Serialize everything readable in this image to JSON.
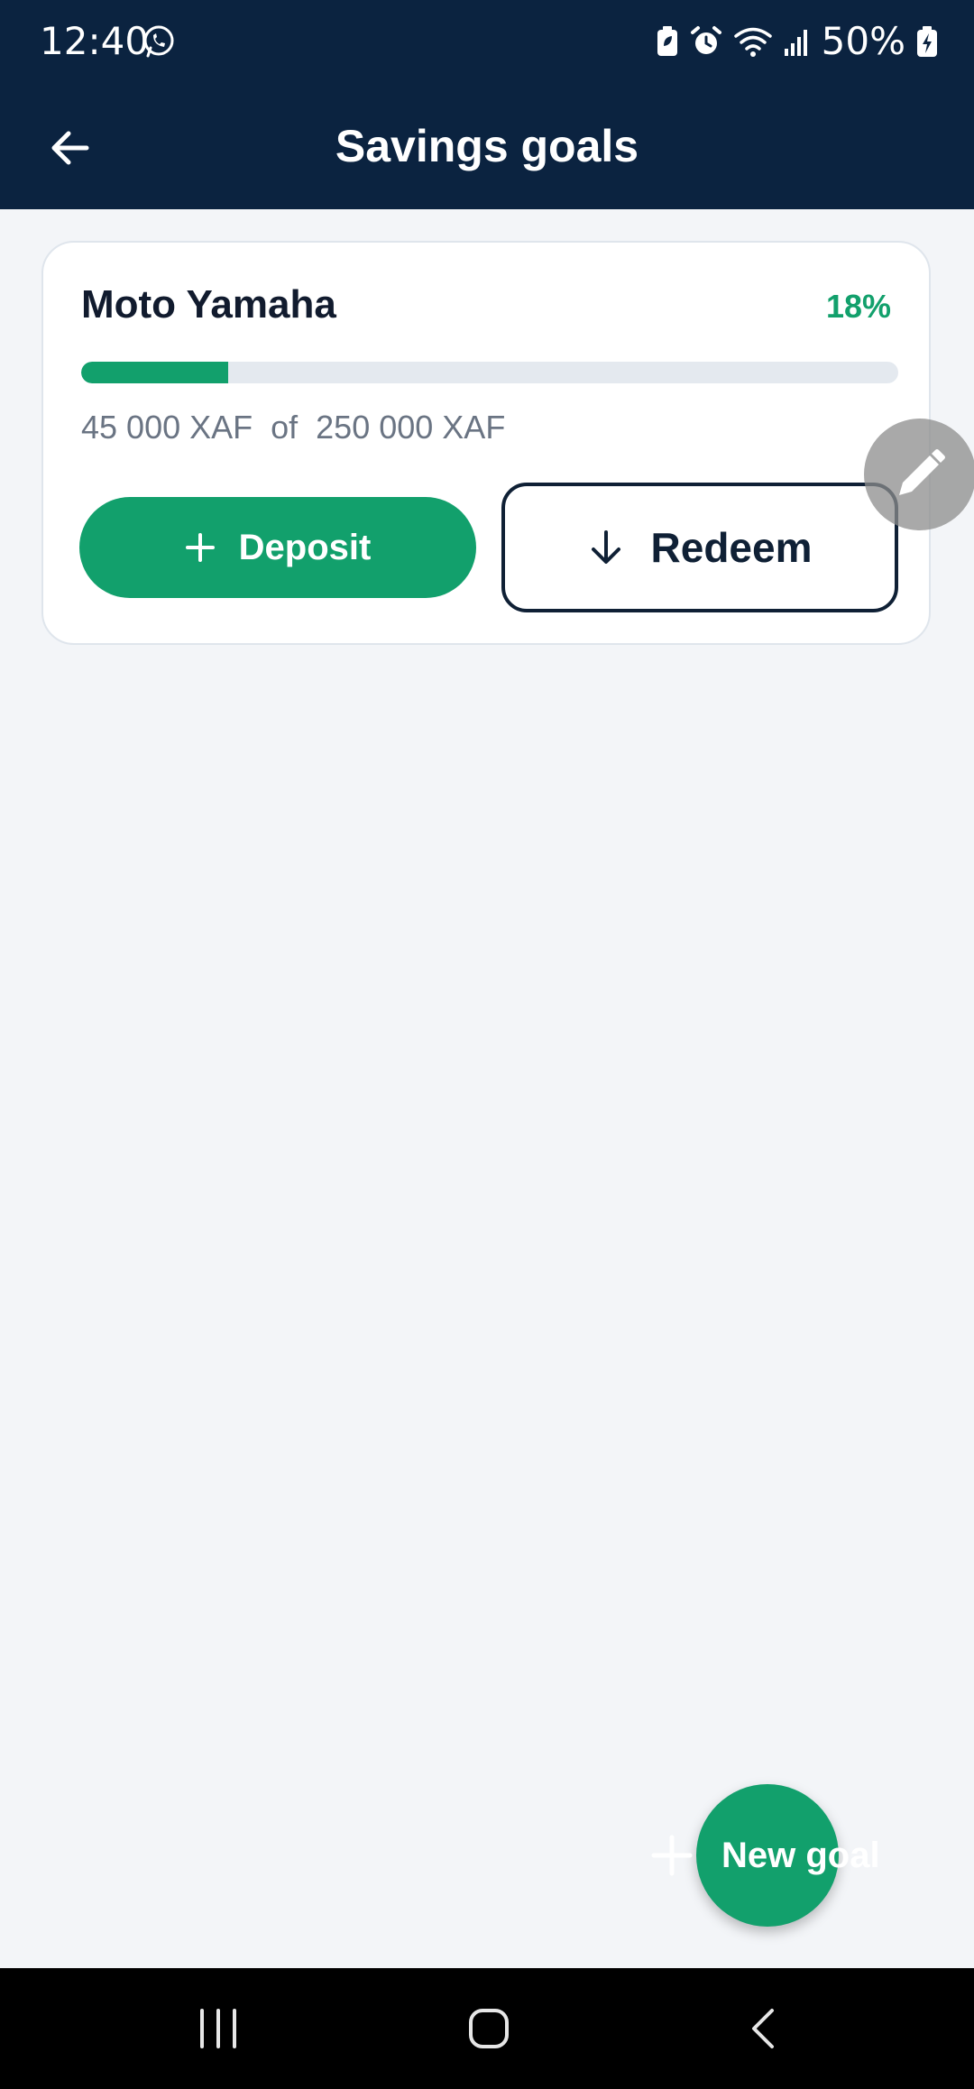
{
  "status_bar": {
    "time": "12:40",
    "battery": "50%",
    "icons": [
      "whatsapp-icon",
      "battery-saver-icon",
      "alarm-icon",
      "wifi-icon",
      "signal-icon",
      "battery-charging-icon"
    ]
  },
  "header": {
    "title": "Savings goals",
    "back_icon": "arrow-left-icon"
  },
  "goals": [
    {
      "name": "Moto Yamaha",
      "percent_label": "18%",
      "progress": 0.18,
      "amounts": "45 000 XAF  of  250 000 XAF",
      "deposit_label": "Deposit",
      "redeem_label": "Redeem"
    }
  ],
  "fab": {
    "new_goal_label": "New goal",
    "edit_icon": "pencil-icon"
  },
  "colors": {
    "header_bg": "#0b2340",
    "accent": "#12a06c",
    "background": "#f3f5f8",
    "text_dark": "#111b2e",
    "text_muted": "#6a7483"
  }
}
